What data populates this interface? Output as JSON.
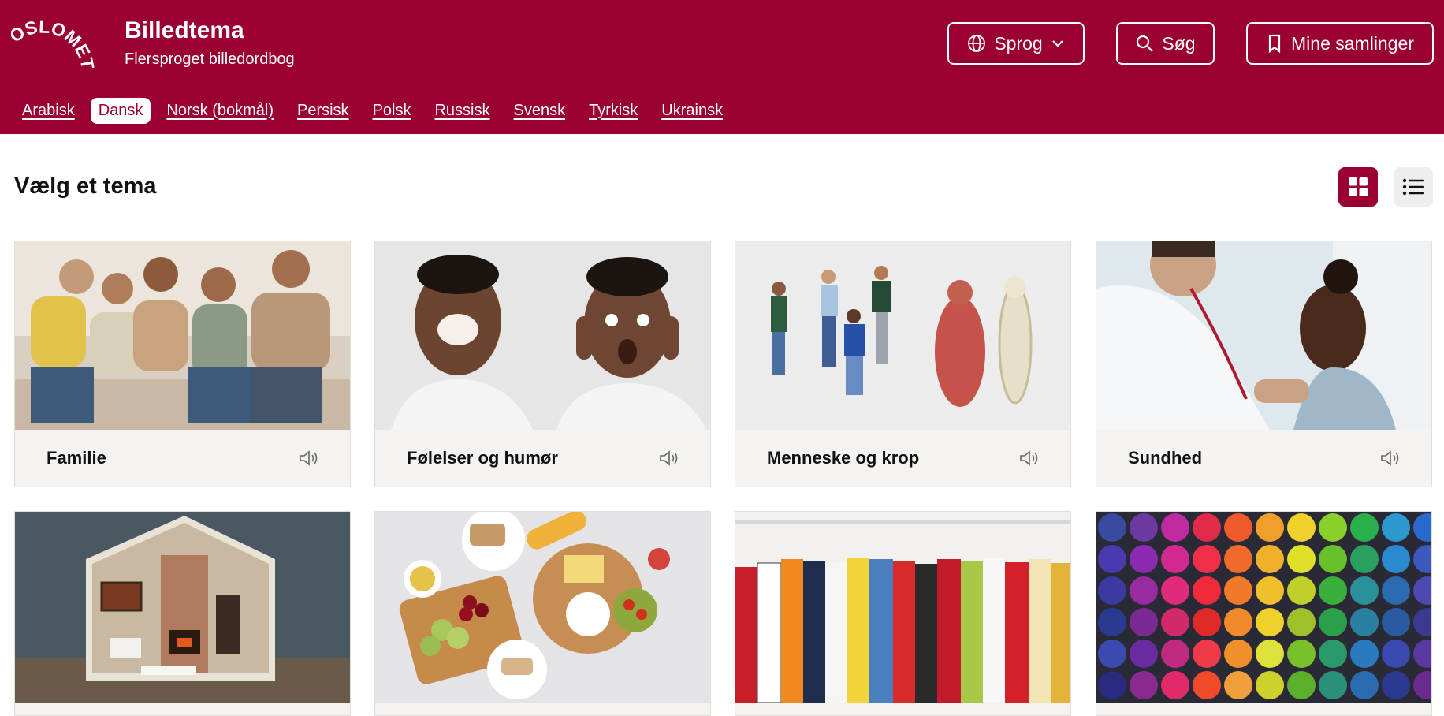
{
  "brand": {
    "logo_text": "OSLOMET",
    "title": "Billedtema",
    "subtitle": "Flersproget billedordbog"
  },
  "header_buttons": {
    "language": "Sprog",
    "search": "Søg",
    "collections": "Mine samlinger"
  },
  "languages": [
    {
      "label": "Arabisk",
      "active": false
    },
    {
      "label": "Dansk",
      "active": true
    },
    {
      "label": "Norsk (bokmål)",
      "active": false
    },
    {
      "label": "Persisk",
      "active": false
    },
    {
      "label": "Polsk",
      "active": false
    },
    {
      "label": "Russisk",
      "active": false
    },
    {
      "label": "Svensk",
      "active": false
    },
    {
      "label": "Tyrkisk",
      "active": false
    },
    {
      "label": "Ukrainsk",
      "active": false
    }
  ],
  "main": {
    "title": "Vælg et tema"
  },
  "themes": [
    {
      "label": "Familie",
      "icon": "speaker-icon"
    },
    {
      "label": "Følelser og humør",
      "icon": "speaker-icon"
    },
    {
      "label": "Menneske og krop",
      "icon": "speaker-icon"
    },
    {
      "label": "Sundhed",
      "icon": "speaker-icon"
    }
  ],
  "colors": {
    "brand": "#9a0032",
    "card_bg": "#f4f3f1"
  }
}
